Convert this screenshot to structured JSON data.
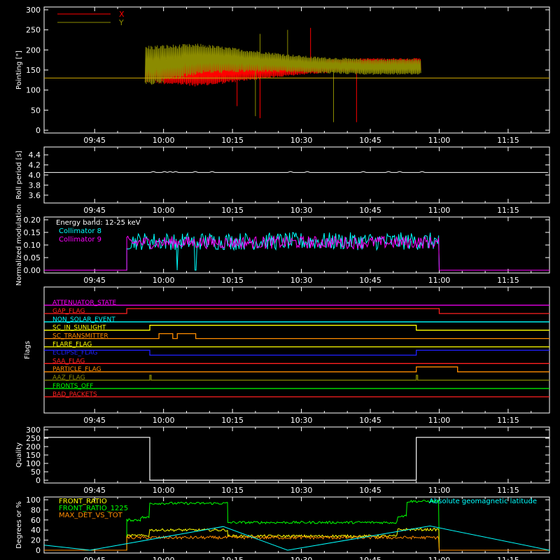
{
  "x_ticks": [
    "09:45",
    "10:00",
    "10:15",
    "10:30",
    "10:45",
    "11:00",
    "11:15"
  ],
  "chart_data": [
    {
      "id": "pointing",
      "type": "line",
      "ylabel": "Pointing [\"]",
      "ylim": [
        0,
        300
      ],
      "yticks": [
        "0",
        "50",
        "100",
        "150",
        "200",
        "250",
        "300"
      ],
      "legend": [
        {
          "name": "X",
          "color": "#ff0000"
        },
        {
          "name": "Y",
          "color": "#8b8b00"
        }
      ],
      "series": [
        {
          "name": "X",
          "color": "#ff0000",
          "x_range": [
            "09:56",
            "10:56"
          ],
          "center": [
            [
              0.0,
              150
            ],
            [
              0.2,
              143
            ],
            [
              0.4,
              150
            ],
            [
              0.6,
              158
            ],
            [
              0.8,
              164
            ],
            [
              1.0,
              164
            ]
          ],
          "amplitude": [
            [
              0.0,
              32
            ],
            [
              0.2,
              35
            ],
            [
              0.4,
              25
            ],
            [
              0.6,
              18
            ],
            [
              0.8,
              16
            ],
            [
              1.0,
              16
            ]
          ]
        },
        {
          "name": "Y",
          "color": "#8b8b00",
          "x_range": [
            "09:56",
            "10:56"
          ],
          "center": [
            [
              0.0,
              160
            ],
            [
              0.2,
              178
            ],
            [
              0.4,
              172
            ],
            [
              0.6,
              163
            ],
            [
              0.8,
              158
            ],
            [
              1.0,
              158
            ]
          ],
          "amplitude": [
            [
              0.0,
              52
            ],
            [
              0.2,
              38
            ],
            [
              0.4,
              27
            ],
            [
              0.6,
              21
            ],
            [
              0.8,
              20
            ],
            [
              1.0,
              20
            ]
          ]
        }
      ],
      "reference_line": 130
    },
    {
      "id": "roll",
      "type": "line",
      "ylabel": "Roll period [s]",
      "ylim": [
        3.5,
        4.5
      ],
      "yticks": [
        "3.6",
        "3.8",
        "4.0",
        "4.2",
        "4.4"
      ],
      "series": [
        {
          "name": "roll",
          "color": "#ffffff",
          "value": 4.05
        }
      ]
    },
    {
      "id": "modulation",
      "type": "line",
      "ylabel": "Normalized modulation",
      "ylim": [
        0,
        0.2
      ],
      "yticks": [
        "0.00",
        "0.05",
        "0.10",
        "0.15",
        "0.20"
      ],
      "annotation": "Energy band: 12-25 keV",
      "series": [
        {
          "name": "Collimator 8",
          "color": "#00ffff",
          "x_range": [
            "09:52",
            "11:00"
          ],
          "mean": 0.115,
          "dropouts": [
            "10:03",
            "10:07"
          ]
        },
        {
          "name": "Collimator 9",
          "color": "#ff00ff",
          "x_range": [
            "09:52",
            "11:00"
          ],
          "mean": 0.11
        }
      ]
    },
    {
      "id": "flags",
      "type": "line",
      "ylabel": "Flags",
      "flags": [
        {
          "name": "ATTENUATOR_STATE",
          "color": "#ff00ff",
          "steps": [
            [
              0,
              0
            ]
          ]
        },
        {
          "name": "GAP_FLAG",
          "color": "#ff2020",
          "steps": [
            [
              0,
              0
            ],
            [
              "09:52",
              1
            ],
            [
              "11:00",
              0
            ]
          ]
        },
        {
          "name": "NON_SOLAR_EVENT",
          "color": "#00ffff",
          "steps": [
            [
              0,
              0
            ]
          ]
        },
        {
          "name": "SC_IN_SUNLIGHT",
          "color": "#ffff00",
          "steps": [
            [
              0,
              0
            ],
            [
              "09:57",
              1
            ],
            [
              "10:55",
              0
            ]
          ]
        },
        {
          "name": "SC_TRANSMITTER",
          "color": "#ff8c00",
          "steps": [
            [
              0,
              0
            ],
            [
              "09:59",
              1
            ],
            [
              "10:02",
              0
            ],
            [
              "10:03",
              1
            ],
            [
              "10:07",
              0
            ]
          ]
        },
        {
          "name": "FLARE_FLAG",
          "color": "#ffff00",
          "steps": [
            [
              0,
              0
            ]
          ]
        },
        {
          "name": "ECLIPSE_FLAG",
          "color": "#2020ff",
          "steps": [
            [
              0,
              1
            ],
            [
              "09:57",
              0
            ],
            [
              "10:55",
              1
            ]
          ]
        },
        {
          "name": "SAA_FLAG",
          "color": "#ff2020",
          "steps": [
            [
              0,
              0
            ]
          ]
        },
        {
          "name": "PARTICLE_FLAG",
          "color": "#ff8c00",
          "steps": [
            [
              0,
              0
            ],
            [
              "10:55",
              1
            ],
            [
              "11:04",
              0
            ]
          ]
        },
        {
          "name": "AAZ_FLAG",
          "color": "#8b8b00",
          "steps": [
            [
              0,
              0
            ],
            [
              "09:57",
              1
            ],
            [
              "09:57.3",
              0
            ],
            [
              "10:55",
              1
            ],
            [
              "10:55.3",
              0
            ]
          ]
        },
        {
          "name": "FRONTS_OFF",
          "color": "#00ff00",
          "steps": [
            [
              0,
              0
            ]
          ]
        },
        {
          "name": "BAD_PACKETS",
          "color": "#ff2020",
          "steps": [
            [
              0,
              0
            ]
          ]
        }
      ]
    },
    {
      "id": "quality",
      "type": "line",
      "ylabel": "Quality",
      "ylim": [
        0,
        300
      ],
      "yticks": [
        "0",
        "50",
        "100",
        "150",
        "200",
        "250",
        "300"
      ],
      "series": [
        {
          "name": "quality",
          "color": "#ffffff",
          "steps": [
            [
              0,
              255
            ],
            [
              "09:57",
              0
            ],
            [
              "10:55",
              255
            ]
          ]
        }
      ]
    },
    {
      "id": "ratios",
      "type": "line",
      "ylabel": "Degrees or %",
      "ylim": [
        0,
        100
      ],
      "yticks": [
        "0",
        "20",
        "40",
        "60",
        "80",
        "100"
      ],
      "legend": [
        {
          "name": "FRONT_RATIO",
          "color": "#ffff00"
        },
        {
          "name": "FRONT_RATIO_1225",
          "color": "#00ff00"
        },
        {
          "name": "MAX_DET_VS_TOT",
          "color": "#ff8c00"
        }
      ],
      "annotation": "Absolute geomagnetic latitude",
      "annotation_color": "#00ffff",
      "series": [
        {
          "name": "FRONT_RATIO_1225",
          "color": "#00ff00",
          "levels": [
            [
              "09:52",
              60
            ],
            [
              "09:55",
              65
            ],
            [
              "09:57",
              93
            ],
            [
              "10:14",
              55
            ],
            [
              "10:51",
              68
            ],
            [
              "10:53",
              97
            ],
            [
              "11:00",
              null
            ]
          ]
        },
        {
          "name": "FRONT_RATIO",
          "color": "#ffff00",
          "levels": [
            [
              "09:52",
              29
            ],
            [
              "09:57",
              40
            ],
            [
              "10:14",
              28
            ],
            [
              "10:51",
              41
            ],
            [
              "11:00",
              null
            ]
          ]
        },
        {
          "name": "MAX_DET_VS_TOT",
          "color": "#ff8c00",
          "levels": [
            [
              "09:52",
              25
            ],
            [
              "11:00",
              null
            ]
          ]
        },
        {
          "name": "Absolute geomagnetic latitude",
          "color": "#00ffff",
          "points": [
            [
              "09:34",
              10
            ],
            [
              "09:44",
              0
            ],
            [
              "10:13",
              47
            ],
            [
              "10:27",
              0
            ],
            [
              "10:58",
              48
            ],
            [
              "11:24",
              0
            ]
          ]
        }
      ]
    }
  ]
}
